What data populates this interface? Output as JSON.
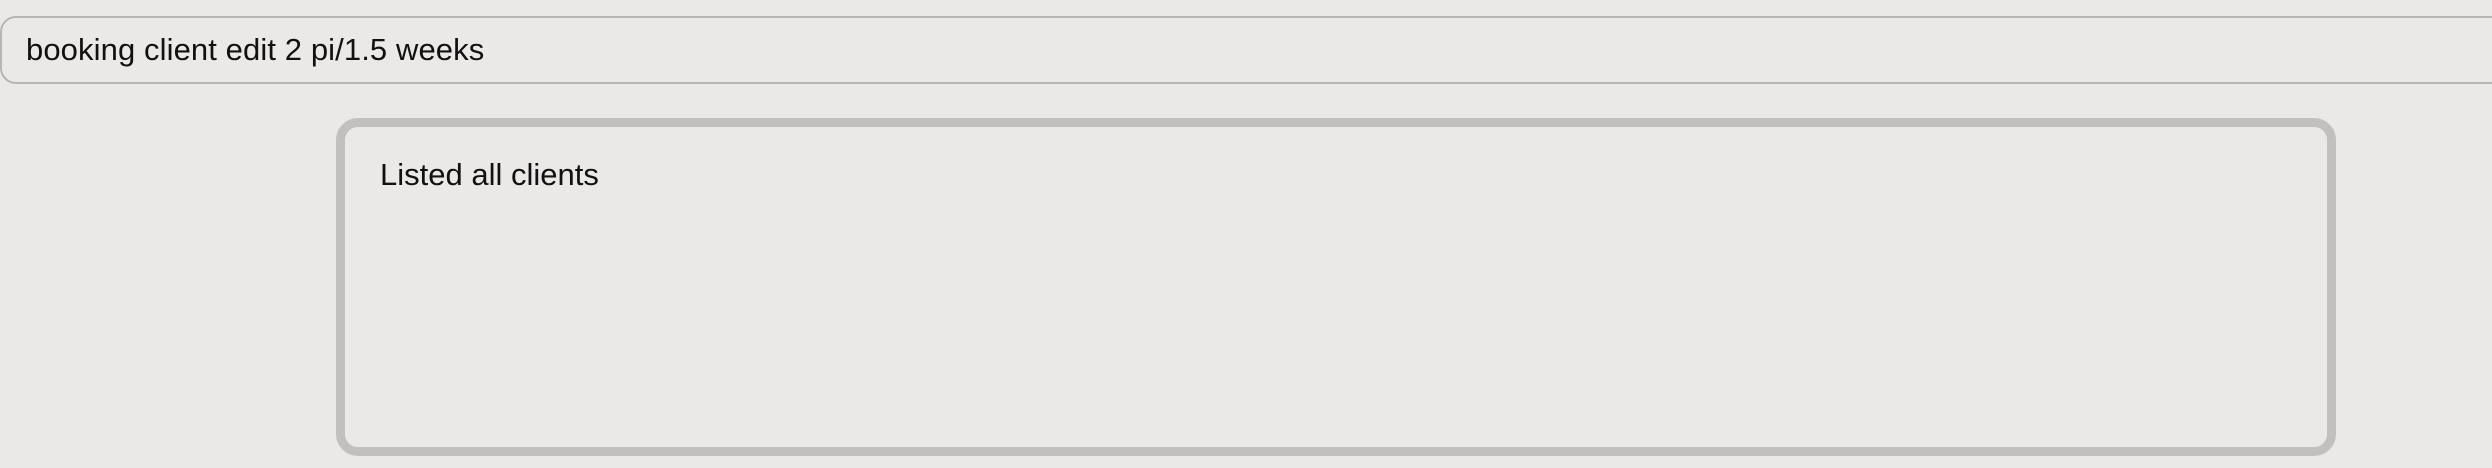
{
  "command_box": {
    "value": "booking client edit 2 pi/1.5 weeks"
  },
  "result_display": {
    "text": "Listed all clients"
  }
}
